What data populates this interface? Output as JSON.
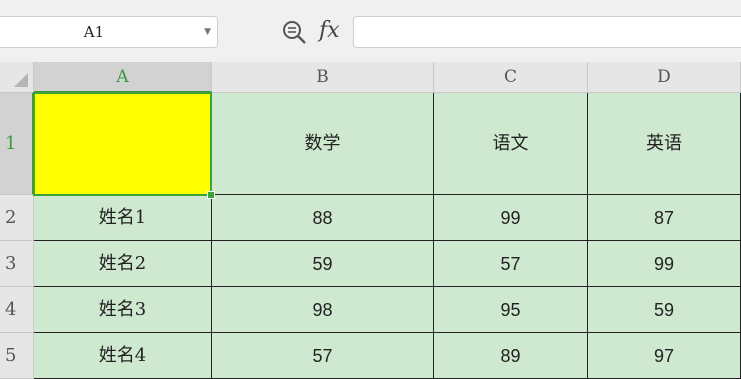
{
  "formula_bar": {
    "name_box": "A1",
    "zoom_icon": "zoom-formula-icon",
    "fx_label": "fx",
    "formula_value": ""
  },
  "columns": [
    "A",
    "B",
    "C",
    "D"
  ],
  "rows": [
    "1",
    "2",
    "3",
    "4",
    "5"
  ],
  "header_row": [
    "",
    "数学",
    "语文",
    "英语"
  ],
  "data_rows": [
    [
      "姓名1",
      "88",
      "99",
      "87"
    ],
    [
      "姓名2",
      "59",
      "57",
      "99"
    ],
    [
      "姓名3",
      "98",
      "95",
      "59"
    ],
    [
      "姓名4",
      "57",
      "89",
      "97"
    ]
  ],
  "colors": {
    "cell_fill": "#cfe8d0",
    "selected_cell_fill": "#ffff00",
    "selection_border": "#3aa33a"
  },
  "selected_cell": "A1"
}
